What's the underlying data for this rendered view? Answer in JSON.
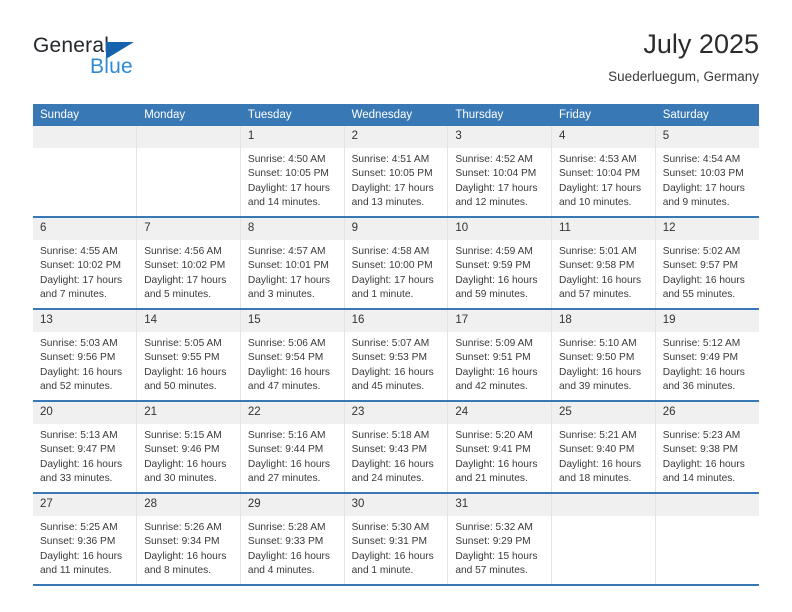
{
  "brand": {
    "name_part1": "General",
    "name_part2": "Blue",
    "triangle_color": "#1663ad",
    "blue_text_color": "#2e8bd4"
  },
  "header": {
    "title": "July 2025",
    "subtitle": "Suederluegum, Germany",
    "accent_color": "#3878b4"
  },
  "weekdays": [
    "Sunday",
    "Monday",
    "Tuesday",
    "Wednesday",
    "Thursday",
    "Friday",
    "Saturday"
  ],
  "weeks": [
    [
      {
        "day": "",
        "lines": []
      },
      {
        "day": "",
        "lines": []
      },
      {
        "day": "1",
        "lines": [
          "Sunrise: 4:50 AM",
          "Sunset: 10:05 PM",
          "Daylight: 17 hours",
          "and 14 minutes."
        ]
      },
      {
        "day": "2",
        "lines": [
          "Sunrise: 4:51 AM",
          "Sunset: 10:05 PM",
          "Daylight: 17 hours",
          "and 13 minutes."
        ]
      },
      {
        "day": "3",
        "lines": [
          "Sunrise: 4:52 AM",
          "Sunset: 10:04 PM",
          "Daylight: 17 hours",
          "and 12 minutes."
        ]
      },
      {
        "day": "4",
        "lines": [
          "Sunrise: 4:53 AM",
          "Sunset: 10:04 PM",
          "Daylight: 17 hours",
          "and 10 minutes."
        ]
      },
      {
        "day": "5",
        "lines": [
          "Sunrise: 4:54 AM",
          "Sunset: 10:03 PM",
          "Daylight: 17 hours",
          "and 9 minutes."
        ]
      }
    ],
    [
      {
        "day": "6",
        "lines": [
          "Sunrise: 4:55 AM",
          "Sunset: 10:02 PM",
          "Daylight: 17 hours",
          "and 7 minutes."
        ]
      },
      {
        "day": "7",
        "lines": [
          "Sunrise: 4:56 AM",
          "Sunset: 10:02 PM",
          "Daylight: 17 hours",
          "and 5 minutes."
        ]
      },
      {
        "day": "8",
        "lines": [
          "Sunrise: 4:57 AM",
          "Sunset: 10:01 PM",
          "Daylight: 17 hours",
          "and 3 minutes."
        ]
      },
      {
        "day": "9",
        "lines": [
          "Sunrise: 4:58 AM",
          "Sunset: 10:00 PM",
          "Daylight: 17 hours",
          "and 1 minute."
        ]
      },
      {
        "day": "10",
        "lines": [
          "Sunrise: 4:59 AM",
          "Sunset: 9:59 PM",
          "Daylight: 16 hours",
          "and 59 minutes."
        ]
      },
      {
        "day": "11",
        "lines": [
          "Sunrise: 5:01 AM",
          "Sunset: 9:58 PM",
          "Daylight: 16 hours",
          "and 57 minutes."
        ]
      },
      {
        "day": "12",
        "lines": [
          "Sunrise: 5:02 AM",
          "Sunset: 9:57 PM",
          "Daylight: 16 hours",
          "and 55 minutes."
        ]
      }
    ],
    [
      {
        "day": "13",
        "lines": [
          "Sunrise: 5:03 AM",
          "Sunset: 9:56 PM",
          "Daylight: 16 hours",
          "and 52 minutes."
        ]
      },
      {
        "day": "14",
        "lines": [
          "Sunrise: 5:05 AM",
          "Sunset: 9:55 PM",
          "Daylight: 16 hours",
          "and 50 minutes."
        ]
      },
      {
        "day": "15",
        "lines": [
          "Sunrise: 5:06 AM",
          "Sunset: 9:54 PM",
          "Daylight: 16 hours",
          "and 47 minutes."
        ]
      },
      {
        "day": "16",
        "lines": [
          "Sunrise: 5:07 AM",
          "Sunset: 9:53 PM",
          "Daylight: 16 hours",
          "and 45 minutes."
        ]
      },
      {
        "day": "17",
        "lines": [
          "Sunrise: 5:09 AM",
          "Sunset: 9:51 PM",
          "Daylight: 16 hours",
          "and 42 minutes."
        ]
      },
      {
        "day": "18",
        "lines": [
          "Sunrise: 5:10 AM",
          "Sunset: 9:50 PM",
          "Daylight: 16 hours",
          "and 39 minutes."
        ]
      },
      {
        "day": "19",
        "lines": [
          "Sunrise: 5:12 AM",
          "Sunset: 9:49 PM",
          "Daylight: 16 hours",
          "and 36 minutes."
        ]
      }
    ],
    [
      {
        "day": "20",
        "lines": [
          "Sunrise: 5:13 AM",
          "Sunset: 9:47 PM",
          "Daylight: 16 hours",
          "and 33 minutes."
        ]
      },
      {
        "day": "21",
        "lines": [
          "Sunrise: 5:15 AM",
          "Sunset: 9:46 PM",
          "Daylight: 16 hours",
          "and 30 minutes."
        ]
      },
      {
        "day": "22",
        "lines": [
          "Sunrise: 5:16 AM",
          "Sunset: 9:44 PM",
          "Daylight: 16 hours",
          "and 27 minutes."
        ]
      },
      {
        "day": "23",
        "lines": [
          "Sunrise: 5:18 AM",
          "Sunset: 9:43 PM",
          "Daylight: 16 hours",
          "and 24 minutes."
        ]
      },
      {
        "day": "24",
        "lines": [
          "Sunrise: 5:20 AM",
          "Sunset: 9:41 PM",
          "Daylight: 16 hours",
          "and 21 minutes."
        ]
      },
      {
        "day": "25",
        "lines": [
          "Sunrise: 5:21 AM",
          "Sunset: 9:40 PM",
          "Daylight: 16 hours",
          "and 18 minutes."
        ]
      },
      {
        "day": "26",
        "lines": [
          "Sunrise: 5:23 AM",
          "Sunset: 9:38 PM",
          "Daylight: 16 hours",
          "and 14 minutes."
        ]
      }
    ],
    [
      {
        "day": "27",
        "lines": [
          "Sunrise: 5:25 AM",
          "Sunset: 9:36 PM",
          "Daylight: 16 hours",
          "and 11 minutes."
        ]
      },
      {
        "day": "28",
        "lines": [
          "Sunrise: 5:26 AM",
          "Sunset: 9:34 PM",
          "Daylight: 16 hours",
          "and 8 minutes."
        ]
      },
      {
        "day": "29",
        "lines": [
          "Sunrise: 5:28 AM",
          "Sunset: 9:33 PM",
          "Daylight: 16 hours",
          "and 4 minutes."
        ]
      },
      {
        "day": "30",
        "lines": [
          "Sunrise: 5:30 AM",
          "Sunset: 9:31 PM",
          "Daylight: 16 hours",
          "and 1 minute."
        ]
      },
      {
        "day": "31",
        "lines": [
          "Sunrise: 5:32 AM",
          "Sunset: 9:29 PM",
          "Daylight: 15 hours",
          "and 57 minutes."
        ]
      },
      {
        "day": "",
        "lines": []
      },
      {
        "day": "",
        "lines": []
      }
    ]
  ]
}
